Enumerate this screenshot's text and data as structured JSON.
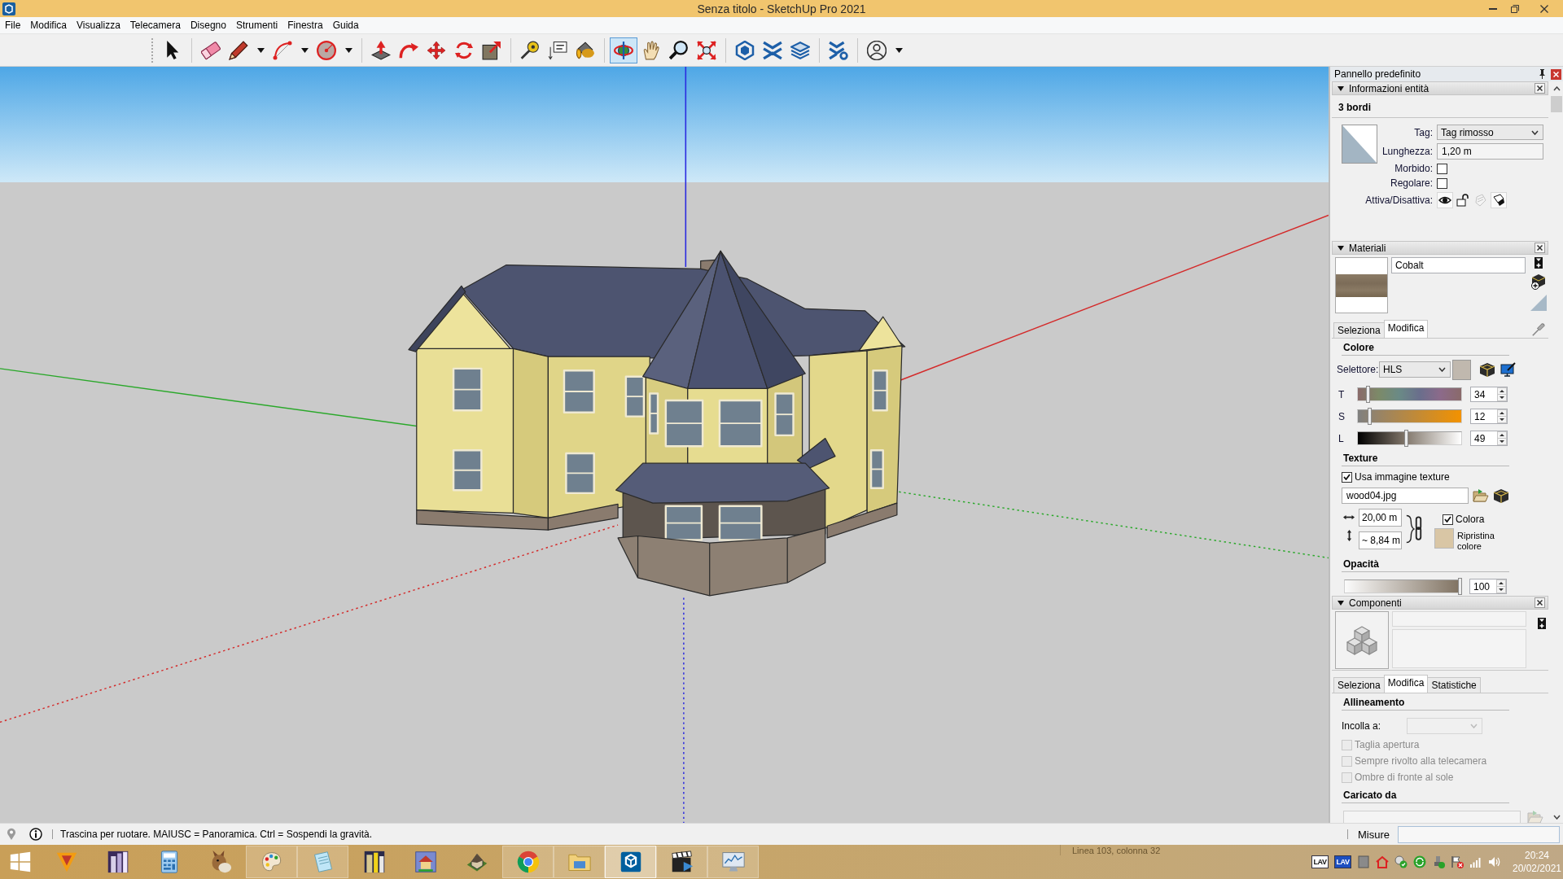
{
  "window": {
    "title": "Senza titolo - SketchUp Pro 2021"
  },
  "menu": [
    "File",
    "Modifica",
    "Visualizza",
    "Telecamera",
    "Disegno",
    "Strumenti",
    "Finestra",
    "Guida"
  ],
  "toolbar": [
    [
      {
        "selected": false,
        "menu": false
      }
    ],
    [
      {
        "selected": false,
        "menu": false
      },
      {
        "selected": false,
        "menu": true
      },
      {
        "selected": false,
        "menu": true
      },
      {
        "selected": false,
        "menu": true
      }
    ],
    [
      {
        "selected": false,
        "menu": false
      },
      {
        "selected": false,
        "menu": false
      },
      {
        "selected": false,
        "menu": false
      },
      {
        "selected": false,
        "menu": false
      },
      {
        "selected": false,
        "menu": false
      }
    ],
    [
      {
        "selected": false,
        "menu": false
      },
      {
        "selected": false,
        "menu": false
      },
      {
        "selected": false,
        "menu": false
      }
    ],
    [
      {
        "selected": true,
        "menu": false
      },
      {
        "selected": false,
        "menu": false
      },
      {
        "selected": false,
        "menu": false
      },
      {
        "selected": false,
        "menu": false
      }
    ],
    [
      {
        "selected": false,
        "menu": false
      },
      {
        "selected": false,
        "menu": false
      },
      {
        "selected": false,
        "menu": false
      }
    ],
    [
      {
        "selected": false,
        "menu": false
      }
    ],
    [
      {
        "selected": false,
        "menu": true
      }
    ]
  ],
  "panel": {
    "title": "Pannello predefinito",
    "entity_info": {
      "title": "Informazioni entità",
      "expanded": true,
      "summary": "3 bordi",
      "fields": [
        {
          "kind": "dropdown",
          "label": "Tag:",
          "value": "Tag rimosso"
        },
        {
          "kind": "text",
          "label": "Lunghezza:",
          "value": "1,20 m"
        },
        {
          "kind": "checkbox",
          "label": "Morbido:",
          "checked": false
        },
        {
          "kind": "checkbox",
          "label": "Regolare:",
          "checked": false
        },
        {
          "kind": "toggles",
          "label": "Attiva/Disattiva:",
          "toggles": [
            {
              "on": true,
              "disabled": false
            },
            {
              "on": false,
              "disabled": false
            },
            {
              "on": false,
              "disabled": true
            },
            {
              "on": true,
              "disabled": false
            }
          ]
        }
      ]
    },
    "materials": {
      "title": "Materiali",
      "expanded": true,
      "name": "Cobalt",
      "tabs": [
        {
          "label": "Seleziona",
          "selected": false
        },
        {
          "label": "Modifica",
          "selected": true
        }
      ],
      "color": {
        "title": "Colore",
        "picker_label": "Selettore:",
        "picker": "HLS",
        "channels": [
          {
            "label": "T",
            "level": 0.1,
            "value": "34"
          },
          {
            "label": "S",
            "level": 0.12,
            "value": "12"
          },
          {
            "label": "L",
            "level": 0.47,
            "value": "49"
          }
        ]
      },
      "texture": {
        "title": "Texture",
        "use_image": {
          "label": "Usa immagine texture",
          "checked": true
        },
        "file": "wood04.jpg",
        "width": "20,00 m",
        "height": "~ 8,84 m",
        "colorize": {
          "label": "Colora",
          "checked": true
        },
        "reset": "Ripristina colore"
      },
      "opacity": {
        "title": "Opacità",
        "level": 1,
        "value": "100"
      }
    },
    "components": {
      "title": "Componenti",
      "expanded": true,
      "tabs": [
        {
          "label": "Seleziona",
          "selected": false
        },
        {
          "label": "Modifica",
          "selected": true
        },
        {
          "label": "Statistiche",
          "selected": false
        }
      ],
      "alignment": {
        "title": "Allineamento",
        "glue_label": "Incolla a:",
        "glue_disabled": true,
        "options": [
          {
            "label": "Taglia apertura",
            "checked": false,
            "disabled": true
          },
          {
            "label": "Sempre rivolto alla telecamera",
            "checked": false,
            "disabled": true
          },
          {
            "label": "Ombre di fronte al sole",
            "checked": false,
            "disabled": true
          }
        ]
      },
      "loaded_from": {
        "title": "Caricato da"
      }
    }
  },
  "status_bar": {
    "hint": "Trascina per ruotare. MAIUSC = Panoramica. Ctrl = Sospendi la gravità.",
    "measure_label": "Misure"
  },
  "taskbar": {
    "apps": [
      {
        "running": false,
        "selected": false
      },
      {
        "running": false,
        "selected": false
      },
      {
        "running": false,
        "selected": false
      },
      {
        "running": false,
        "selected": false
      },
      {
        "running": true,
        "selected": false
      },
      {
        "running": true,
        "selected": false
      },
      {
        "running": false,
        "selected": false
      },
      {
        "running": false,
        "selected": false
      },
      {
        "running": false,
        "selected": false
      },
      {
        "running": true,
        "selected": false
      },
      {
        "running": true,
        "selected": false
      },
      {
        "running": true,
        "selected": true
      },
      {
        "running": true,
        "selected": false
      },
      {
        "running": true,
        "selected": false
      }
    ],
    "background_window_text": "Linea 103, colonna 32",
    "tray_badges": [
      "LAV",
      "LAV"
    ],
    "time": "20:24",
    "date": "20/02/2021"
  }
}
